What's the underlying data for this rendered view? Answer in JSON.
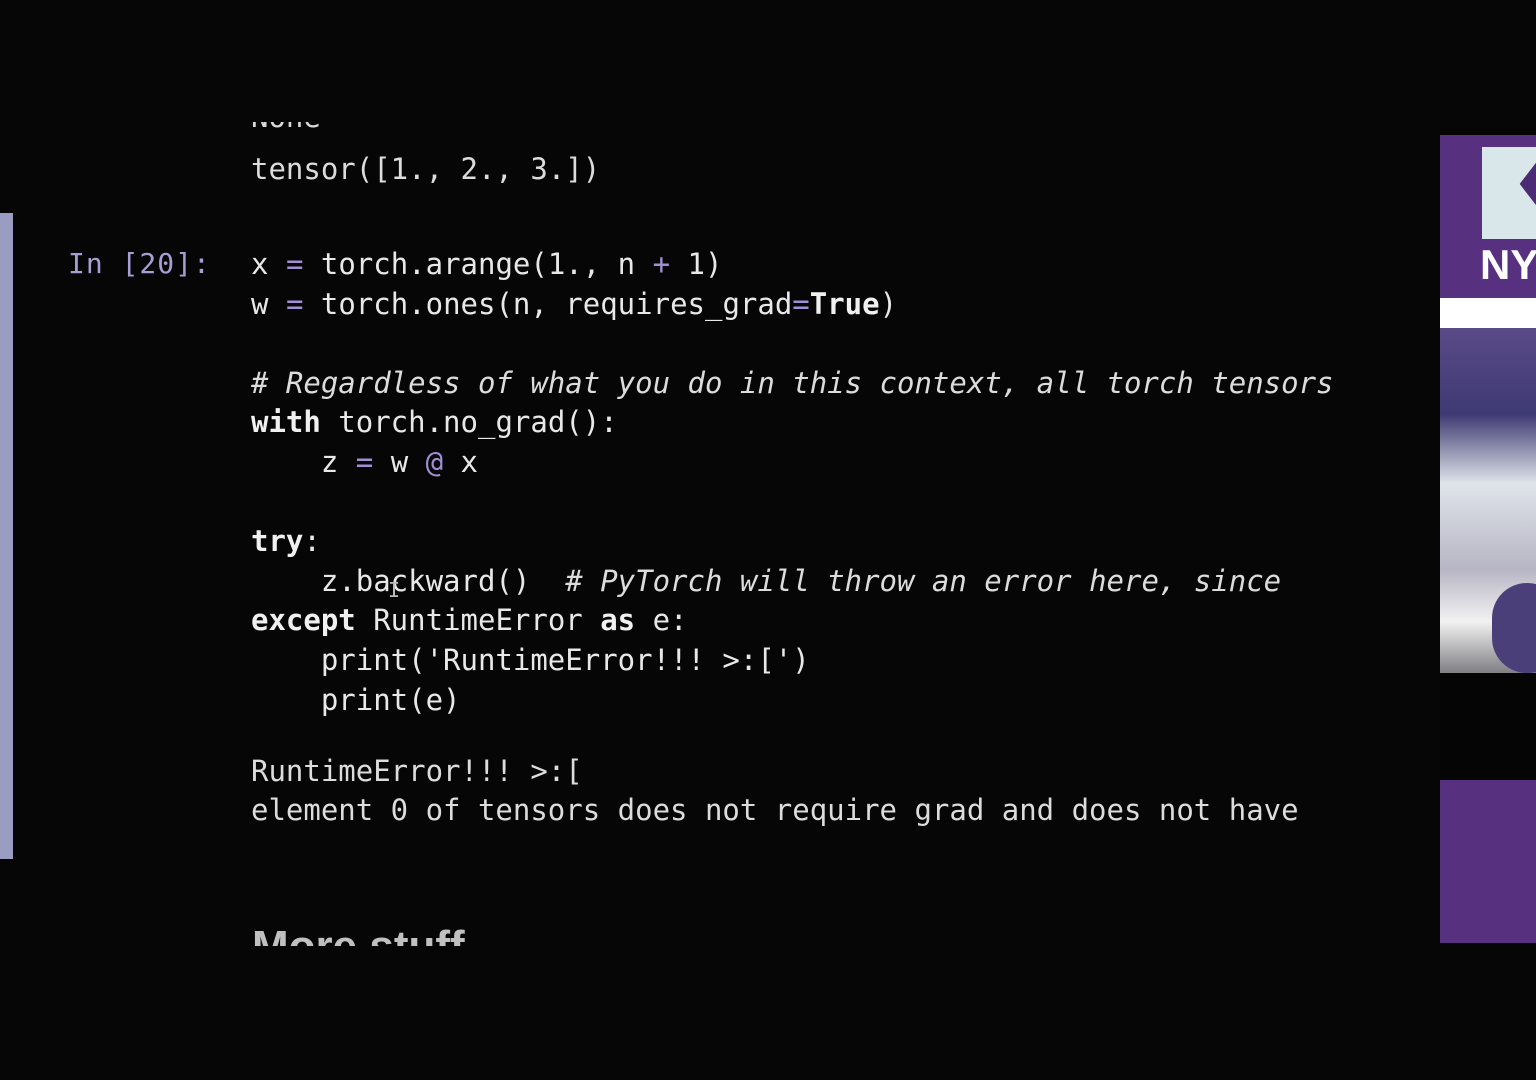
{
  "notebook": {
    "previous_output_partial": "None",
    "previous_output": "tensor([1., 2., 3.])",
    "cell_prompt": "In [20]:",
    "code": {
      "l1_var": "x",
      "l1_eq": "=",
      "l1_call": "torch.arange(1., n ",
      "l1_plus": "+",
      "l1_end": " 1)",
      "l2_var": "w",
      "l2_eq": "=",
      "l2_call": "torch.ones(n, requires_grad",
      "l2_assign": "=",
      "l2_true": "True",
      "l2_end": ")",
      "l3_comment": "# Regardless of what you do in this context, all torch tensors",
      "l4_kw": "with",
      "l4_rest": " torch.no_grad():",
      "l5_a": "    z ",
      "l5_eq": "=",
      "l5_b": " w ",
      "l5_at": "@",
      "l5_c": " x",
      "l6_kw": "try",
      "l6_rest": ":",
      "l7_code": "    z.backward()  ",
      "l7_comment": "# PyTorch will throw an error here, since",
      "l8_kw": "except",
      "l8_mid": " RuntimeError ",
      "l8_as": "as",
      "l8_rest": " e:",
      "l9": "    print('RuntimeError!!! >:[')",
      "l10": "    print(e)"
    },
    "output_line1": "RuntimeError!!! >:[",
    "output_line2": "element 0 of tensors does not require grad and does not have",
    "next_heading": "More stuff"
  },
  "cursor_glyph": "I",
  "video_overlay": {
    "logo_text": "NY",
    "logo_icon": "torch-icon",
    "brand_color": "#57307f"
  }
}
